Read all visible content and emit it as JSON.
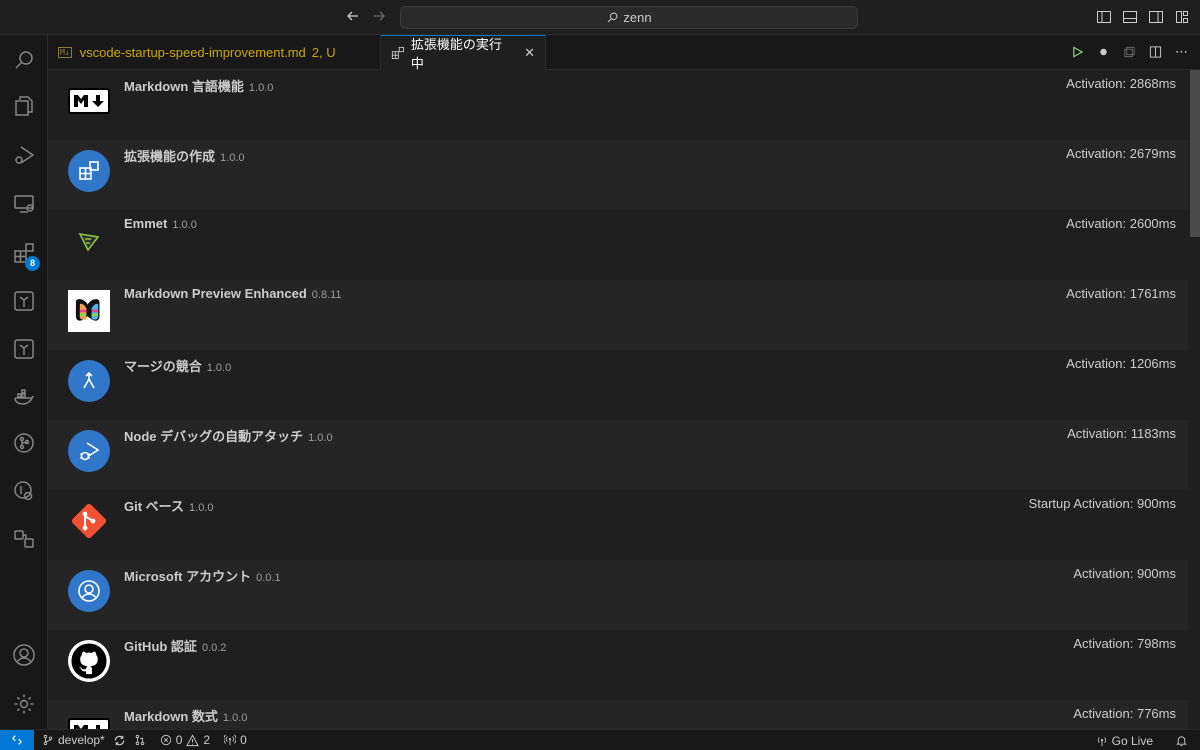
{
  "titlebar": {
    "search_text": "zenn"
  },
  "activitybar": {
    "extensions_badge": "8"
  },
  "tabs": [
    {
      "label": "vscode-startup-speed-improvement.md",
      "badge": "M↓",
      "status": "2, U"
    },
    {
      "label": "拡張機能の実行中",
      "close": "✕"
    }
  ],
  "extensions": [
    {
      "name": "Markdown 言語機能",
      "version": "1.0.0",
      "activation": "Activation: 2868ms",
      "icon": "markdown-icon"
    },
    {
      "name": "拡張機能の作成",
      "version": "1.0.0",
      "activation": "Activation: 2679ms",
      "icon": "extensions-icon"
    },
    {
      "name": "Emmet",
      "version": "1.0.0",
      "activation": "Activation: 2600ms",
      "icon": "emmet-icon"
    },
    {
      "name": "Markdown Preview Enhanced",
      "version": "0.8.11",
      "activation": "Activation: 1761ms",
      "icon": "mpe-icon"
    },
    {
      "name": "マージの競合",
      "version": "1.0.0",
      "activation": "Activation: 1206ms",
      "icon": "merge-icon"
    },
    {
      "name": "Node デバッグの自動アタッチ",
      "version": "1.0.0",
      "activation": "Activation: 1183ms",
      "icon": "debug-icon"
    },
    {
      "name": "Git ベース",
      "version": "1.0.0",
      "activation": "Startup Activation: 900ms",
      "icon": "git-icon"
    },
    {
      "name": "Microsoft アカウント",
      "version": "0.0.1",
      "activation": "Activation: 900ms",
      "icon": "account-icon"
    },
    {
      "name": "GitHub 認証",
      "version": "0.0.2",
      "activation": "Activation: 798ms",
      "icon": "github-icon"
    },
    {
      "name": "Markdown 数式",
      "version": "1.0.0",
      "activation": "Activation: 776ms",
      "icon": "markdown-icon"
    }
  ],
  "statusbar": {
    "branch": "develop*",
    "errors": "0",
    "warnings": "2",
    "ports": "0",
    "go_live": "Go Live"
  },
  "colors": {
    "accent": "#0078d4",
    "ext_icon_bg": "#3077c9",
    "git_orange": "#f05133",
    "modified": "#cca700"
  }
}
